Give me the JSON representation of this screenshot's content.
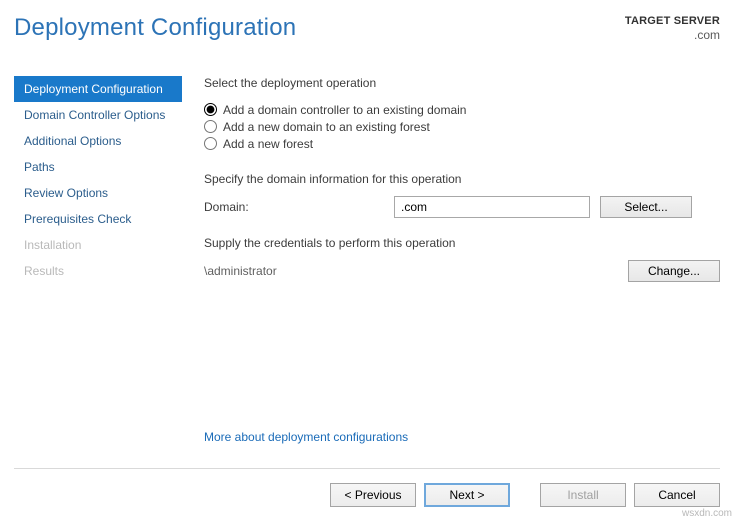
{
  "header": {
    "title": "Deployment Configuration",
    "target_label": "TARGET SERVER",
    "target_value": ".com"
  },
  "sidebar": {
    "items": [
      {
        "label": "Deployment Configuration",
        "state": "selected"
      },
      {
        "label": "Domain Controller Options",
        "state": "normal"
      },
      {
        "label": "Additional Options",
        "state": "normal"
      },
      {
        "label": "Paths",
        "state": "normal"
      },
      {
        "label": "Review Options",
        "state": "normal"
      },
      {
        "label": "Prerequisites Check",
        "state": "normal"
      },
      {
        "label": "Installation",
        "state": "disabled"
      },
      {
        "label": "Results",
        "state": "disabled"
      }
    ]
  },
  "content": {
    "select_op_label": "Select the deployment operation",
    "radios": [
      {
        "label": "Add a domain controller to an existing domain",
        "checked": true
      },
      {
        "label": "Add a new domain to an existing forest",
        "checked": false
      },
      {
        "label": "Add a new forest",
        "checked": false
      }
    ],
    "domain_info_label": "Specify the domain information for this operation",
    "domain_label": "Domain:",
    "domain_value": ".com",
    "select_button": "Select...",
    "credentials_label": "Supply the credentials to perform this operation",
    "credentials_value": "\\administrator",
    "change_button": "Change...",
    "more_link": "More about deployment configurations"
  },
  "footer": {
    "previous": "< Previous",
    "next": "Next >",
    "install": "Install",
    "cancel": "Cancel"
  },
  "watermark": "wsxdn.com"
}
